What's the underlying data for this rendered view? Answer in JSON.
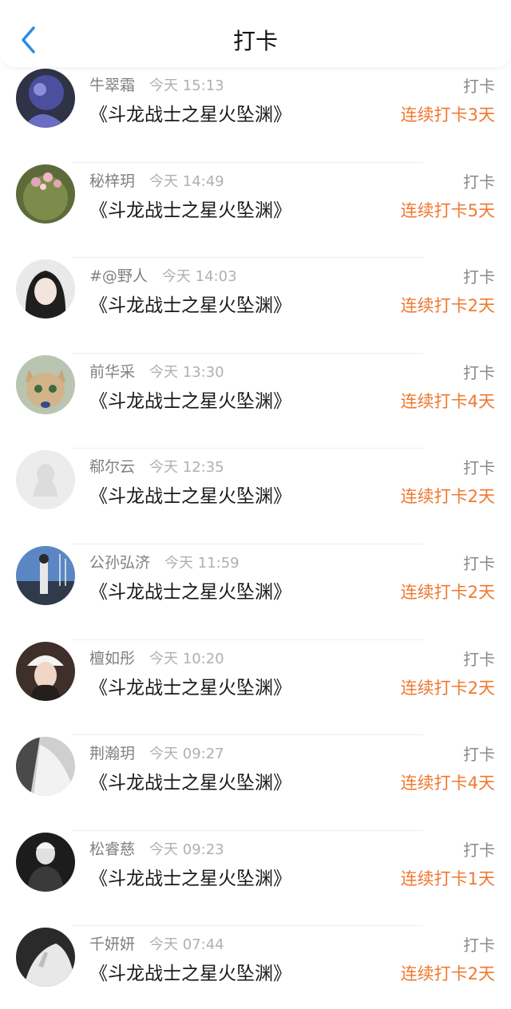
{
  "header": {
    "title": "打卡",
    "back_icon": "chevron-left-icon",
    "accent_color": "#2b8be6"
  },
  "entries": [
    {
      "name": "牛翠霜",
      "time": "今天 15:13",
      "book": "《斗龙战士之星火坠渊》",
      "action": "打卡",
      "streak": "连续打卡3天",
      "avatar": "purple-art"
    },
    {
      "name": "秘梓玥",
      "time": "今天 14:49",
      "book": "《斗龙战士之星火坠渊》",
      "action": "打卡",
      "streak": "连续打卡5天",
      "avatar": "cactus-flower"
    },
    {
      "name": "#@野人",
      "time": "今天 14:03",
      "book": "《斗龙战士之星火坠渊》",
      "action": "打卡",
      "streak": "连续打卡2天",
      "avatar": "anime-girl"
    },
    {
      "name": "前华采",
      "time": "今天 13:30",
      "book": "《斗龙战士之星火坠渊》",
      "action": "打卡",
      "streak": "连续打卡4天",
      "avatar": "cat"
    },
    {
      "name": "郗尔云",
      "time": "今天 12:35",
      "book": "《斗龙战士之星火坠渊》",
      "action": "打卡",
      "streak": "连续打卡2天",
      "avatar": "default"
    },
    {
      "name": "公孙弘济",
      "time": "今天 11:59",
      "book": "《斗龙战士之星火坠渊》",
      "action": "打卡",
      "streak": "连续打卡2天",
      "avatar": "harbor-photo"
    },
    {
      "name": "檀如彤",
      "time": "今天 10:20",
      "book": "《斗龙战士之星火坠渊》",
      "action": "打卡",
      "streak": "连续打卡2天",
      "avatar": "girl-portrait"
    },
    {
      "name": "荆瀚玥",
      "time": "今天 09:27",
      "book": "《斗龙战士之星火坠渊》",
      "action": "打卡",
      "streak": "连续打卡4天",
      "avatar": "bw-shirt"
    },
    {
      "name": "松睿慈",
      "time": "今天 09:23",
      "book": "《斗龙战士之星火坠渊》",
      "action": "打卡",
      "streak": "连续打卡1天",
      "avatar": "bw-person"
    },
    {
      "name": "千妍妍",
      "time": "今天 07:44",
      "book": "《斗龙战士之星火坠渊》",
      "action": "打卡",
      "streak": "连续打卡2天",
      "avatar": "bw-hand"
    }
  ]
}
